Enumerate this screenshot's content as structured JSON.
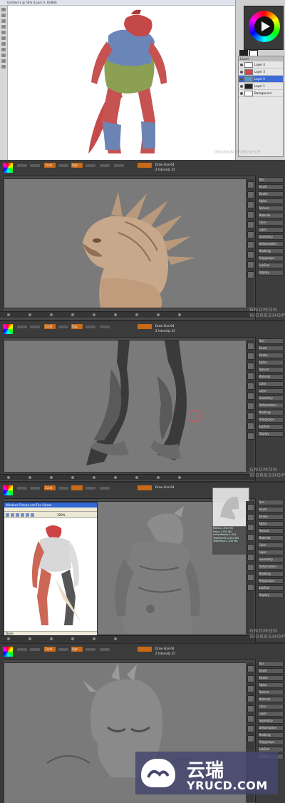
{
  "photoshop": {
    "title": "Untitled-1 @ 50% (Layer 0, RGB/8)",
    "layers_title": "Layers",
    "layers": [
      "Layer 4",
      "Layer 3",
      "Layer 2",
      "Layer 1",
      "Background"
    ],
    "watermark": "GNOMON WORKSHOP"
  },
  "zbrush": {
    "panel1": {
      "mode_label": "Standard",
      "zadd": "Zadd",
      "rgb": "Rgb",
      "draw_size": "Draw Size 64",
      "z_intensity": "Z Intensity 25",
      "watermark": "GNOMON WORKSHOP"
    },
    "panel2": {
      "mode_label": "Standard",
      "zadd": "Zadd",
      "rgb": "Rgb",
      "draw_size": "Draw Size 64",
      "z_intensity": "Z Intensity 25",
      "watermark": "GNOMON WORKSHOP"
    },
    "panel3": {
      "mode_label": "Standard",
      "zadd": "Zadd",
      "draw_size": "Draw Size 64",
      "browser_title": "Windows Picture and Fax Viewer",
      "zoom": "100%",
      "status": "Done",
      "tooltip_lines": [
        "Points:1.554 Mil",
        "Polys:1.532 Mil",
        "ActivePoints:1.554",
        "TotalPoints:1.554 Mil",
        "TotalPolys:1.532 Mil"
      ],
      "watermark": "GNOMON WORKSHOP"
    },
    "panel4": {
      "mode_label": "Standard",
      "zadd": "Zadd",
      "rgb": "Rgb",
      "draw_size": "Draw Size 64",
      "z_intensity": "Z Intensity 25",
      "watermark": "GNOMON WORKSHOP"
    },
    "right_menu": [
      "Tool",
      "Brush",
      "Stroke",
      "Alpha",
      "Texture",
      "Material",
      "Color",
      "Layer",
      "Geometry",
      "Deformation",
      "Masking",
      "Polygroups",
      "SubTool",
      "Display"
    ]
  },
  "banner": {
    "cn": "云瑞",
    "en": "YRUCD.COM"
  },
  "colors": {
    "ps_bg": "#ffffff",
    "zb_bg": "#4a4a4a",
    "viewport": "#7a7a7a",
    "accent_orange": "#c96a18",
    "banner": "#46466e"
  }
}
